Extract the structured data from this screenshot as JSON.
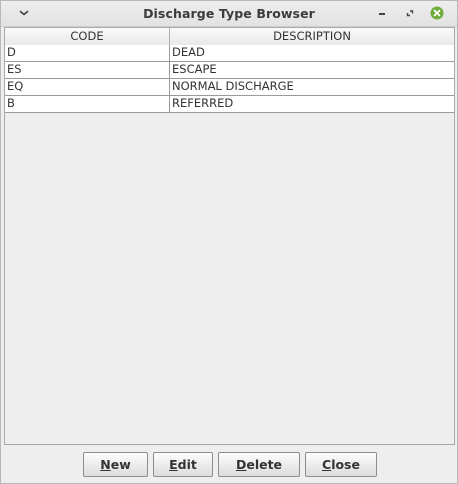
{
  "window": {
    "title": "Discharge Type Browser"
  },
  "icons": {
    "menu": "chevron-down-icon",
    "minimize": "minimize-icon",
    "maximize": "maximize-icon",
    "close": "close-circle-icon",
    "close_color": "#6fae3a"
  },
  "table": {
    "columns": [
      "CODE",
      "DESCRIPTION"
    ],
    "rows": [
      {
        "code": "D",
        "description": "DEAD"
      },
      {
        "code": "ES",
        "description": "ESCAPE"
      },
      {
        "code": "EQ",
        "description": "NORMAL DISCHARGE"
      },
      {
        "code": "B",
        "description": "REFERRED"
      }
    ]
  },
  "buttons": {
    "new": {
      "mnemonic": "N",
      "rest": "ew"
    },
    "edit": {
      "mnemonic": "E",
      "rest": "dit"
    },
    "delete": {
      "mnemonic": "D",
      "rest": "elete"
    },
    "close": {
      "mnemonic": "C",
      "rest": "lose"
    }
  }
}
